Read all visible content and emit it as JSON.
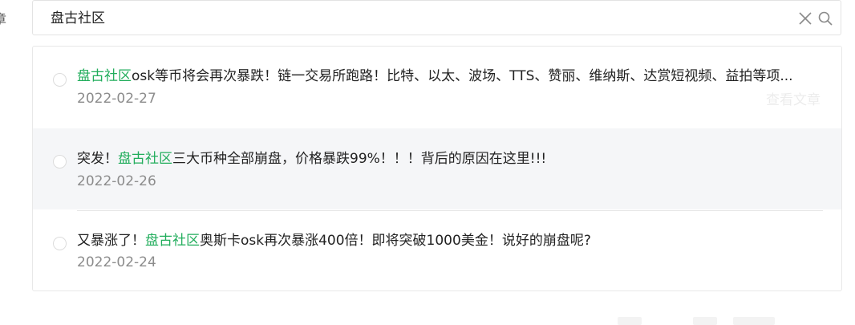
{
  "left_label": "章",
  "search": {
    "value": "盘古社区"
  },
  "icons": {
    "clear": "close-icon",
    "search": "search-icon"
  },
  "colors": {
    "highlight": "#22ad5c",
    "date": "#8c8c8c",
    "hover_bg": "#f5f6f8"
  },
  "results": [
    {
      "prefix": "",
      "keyword": "盘古社区",
      "suffix": "osk等币将会再次暴跌！链一交易所跑路！比特、以太、波场、TTS、赞丽、维纳斯、达赏短视频、益拍等项...",
      "date": "2022-02-27",
      "action": "查看文章"
    },
    {
      "prefix": "突发！",
      "keyword": "盘古社区",
      "suffix": "三大币种全部崩盘，价格暴跌99%！！！背后的原因在这里!!!",
      "date": "2022-02-26"
    },
    {
      "prefix": "又暴涨了！",
      "keyword": "盘古社区",
      "suffix": "奥斯卡osk再次暴涨400倍！即将突破1000美金！说好的崩盘呢?",
      "date": "2022-02-24"
    }
  ]
}
